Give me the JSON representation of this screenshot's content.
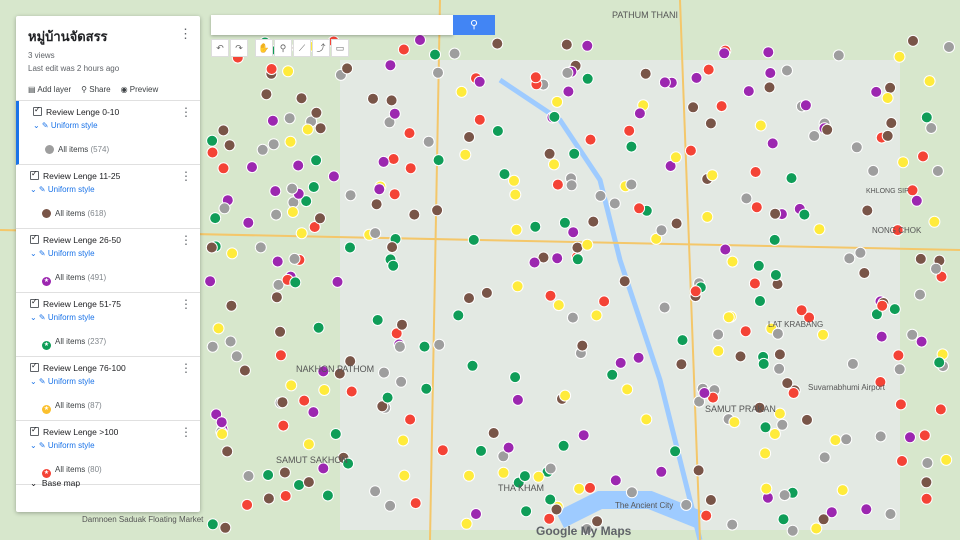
{
  "map": {
    "title": "หมู่บ้านจัดสรร",
    "views": "3 views",
    "last_edit": "Last edit was 2 hours ago",
    "actions": {
      "add_layer": "Add layer",
      "share": "Share",
      "preview": "Preview"
    },
    "base_map": "Base map",
    "logo": "Google My Maps"
  },
  "layers": [
    {
      "name": "Review Lenge 0-10",
      "style": "Uniform style",
      "items_label": "All items",
      "count": "(574)",
      "color": "#9e9e9e"
    },
    {
      "name": "Review Lenge 11-25",
      "style": "Uniform style",
      "items_label": "All items",
      "count": "(618)",
      "color": "#795548"
    },
    {
      "name": "Review Lenge 26-50",
      "style": "Uniform style",
      "items_label": "All items",
      "count": "(491)",
      "color": "#9c27b0"
    },
    {
      "name": "Review Lenge 51-75",
      "style": "Uniform style",
      "items_label": "All items",
      "count": "(237)",
      "color": "#0f9d58"
    },
    {
      "name": "Review Lenge 76-100",
      "style": "Uniform style",
      "items_label": "All items",
      "count": "(87)",
      "color": "#ffeb3b"
    },
    {
      "name": "Review Lenge >100",
      "style": "Uniform style",
      "items_label": "All items",
      "count": "(80)",
      "color": "#f44336"
    }
  ],
  "places": [
    {
      "text": "PATHUM THANI"
    },
    {
      "text": "NAKHON PATHOM"
    },
    {
      "text": "SAMUT SAKHON"
    },
    {
      "text": "THA KHAM"
    },
    {
      "text": "SAMUT PRAKAN"
    },
    {
      "text": "Suvarnabhumi Airport"
    },
    {
      "text": "NONG CHOK"
    },
    {
      "text": "LAT KRABANG"
    },
    {
      "text": "KHLONG SIP"
    },
    {
      "text": "The Ancient City"
    },
    {
      "text": "Damnoen Saduak Floating Market"
    }
  ]
}
